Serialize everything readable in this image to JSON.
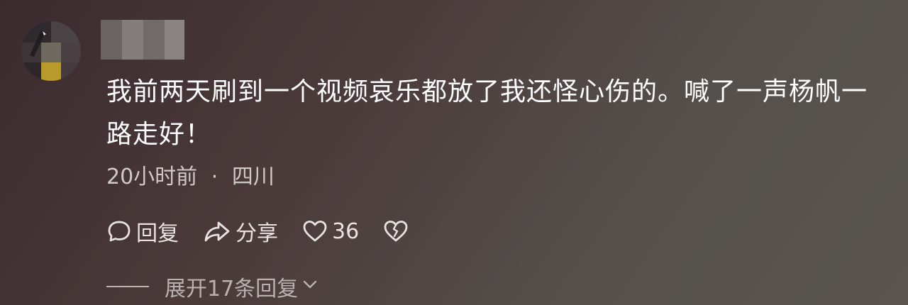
{
  "comment": {
    "text": "我前两天刷到一个视频哀乐都放了我还怪心伤的。喊了一声杨帆一路走好！",
    "time": "20小时前",
    "separator": "·",
    "location": "四川",
    "actions": {
      "reply_label": "回复",
      "share_label": "分享",
      "like_count": "36"
    },
    "expand_label": "展开17条回复",
    "icons": {
      "reply": "speech-bubble-icon",
      "share": "share-arrow-icon",
      "like": "heart-icon",
      "dislike": "broken-heart-icon",
      "expand": "chevron-down-icon"
    }
  },
  "colors": {
    "text": "#ffffff",
    "meta": "#cfc9c7",
    "muted": "#b9b2b0"
  }
}
